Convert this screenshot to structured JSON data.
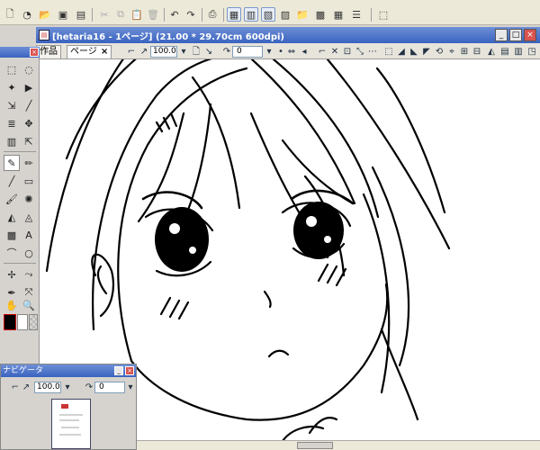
{
  "document": {
    "title": "[hetaria16 - 1ページ] (21.00 * 29.70cm 600dpi)"
  },
  "tabs": [
    {
      "label": "作品",
      "active": false
    },
    {
      "label": "ページ",
      "active": true,
      "close": "×"
    }
  ],
  "view": {
    "zoom": "100.0",
    "rotation": "0"
  },
  "navigator": {
    "title": "ナビゲータ",
    "zoom": "100.0",
    "rotation": "0"
  },
  "colors": {
    "accent": "#3a63c0",
    "close": "#d9534f",
    "toolbar_bg": "#ece9d8",
    "canvas": "#ffffff",
    "main_color": "#000000",
    "sub_color": "#ffffff"
  },
  "icons": {
    "toolbar": [
      "new-icon",
      "open-icon",
      "open-folder-icon",
      "save-icon",
      "save-as-icon",
      "cut-icon",
      "copy-icon",
      "paste-icon",
      "delete-icon",
      "undo-icon",
      "redo-icon",
      "print-icon",
      "window-icon",
      "layer-icon",
      "properties-icon",
      "folder-icon",
      "color-icon",
      "grid-icon",
      "settings-icon"
    ]
  }
}
